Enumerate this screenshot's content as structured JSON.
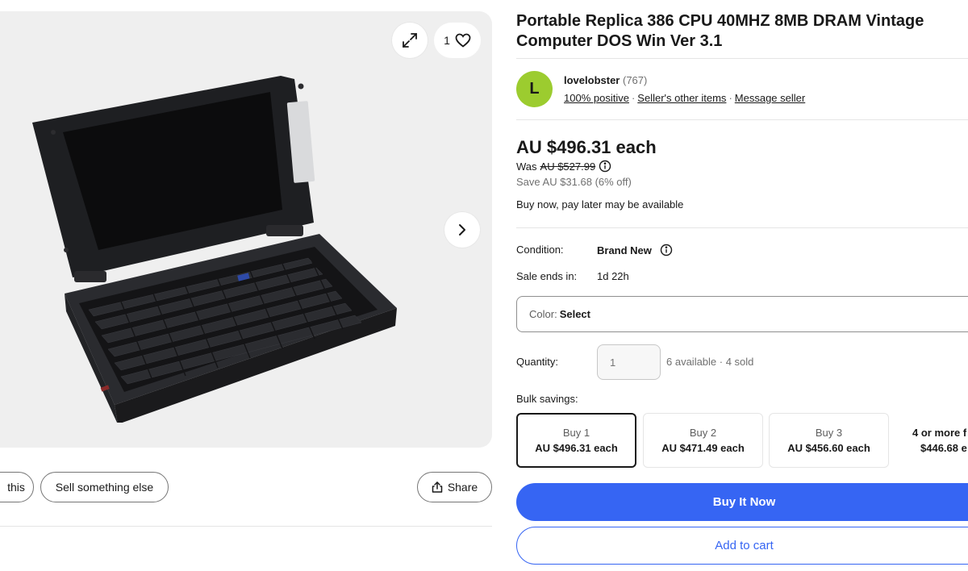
{
  "gallery": {
    "watch_count": "1",
    "icons": {
      "expand": "expand-icon",
      "watch": "heart-icon",
      "next": "chevron-right-icon"
    }
  },
  "actions": {
    "similar_label": "this",
    "sell_label": "Sell something else",
    "share_label": "Share"
  },
  "item": {
    "title": "Portable Replica 386 CPU 40MHZ 8MB DRAM Vintage Computer DOS Win Ver 3.1"
  },
  "seller": {
    "avatar_letter": "L",
    "name": "lovelobster",
    "feedback_count": "(767)",
    "positive": "100% positive",
    "other_items": "Seller's other items",
    "message": "Message seller"
  },
  "pricing": {
    "price": "AU $496.31 each",
    "was_label": "Was",
    "was_price": "AU $527.99",
    "save": "Save AU $31.68 (6% off)",
    "bnpl": "Buy now, pay later may be available"
  },
  "details": {
    "condition_label": "Condition:",
    "condition_value": "Brand New",
    "sale_label": "Sale ends in:",
    "sale_value": "1d 22h",
    "color_label": "Color:",
    "color_value": "Select",
    "quantity_label": "Quantity:",
    "quantity_placeholder": "1",
    "availability": "6 available · 4 sold"
  },
  "bulk": {
    "label": "Bulk savings:",
    "options": [
      {
        "qty": "Buy 1",
        "price": "AU $496.31 each",
        "selected": true
      },
      {
        "qty": "Buy 2",
        "price": "AU $471.49 each",
        "selected": false
      },
      {
        "qty": "Buy 3",
        "price": "AU $456.60 each",
        "selected": false
      },
      {
        "qty": "4 or more f",
        "price": "$446.68 e",
        "selected": false
      }
    ]
  },
  "buttons": {
    "buy_now": "Buy It Now",
    "add_to_cart": "Add to cart"
  },
  "colors": {
    "accent": "#3665f3",
    "avatar": "#9ccc2f",
    "text": "#191919",
    "muted": "#707070"
  }
}
